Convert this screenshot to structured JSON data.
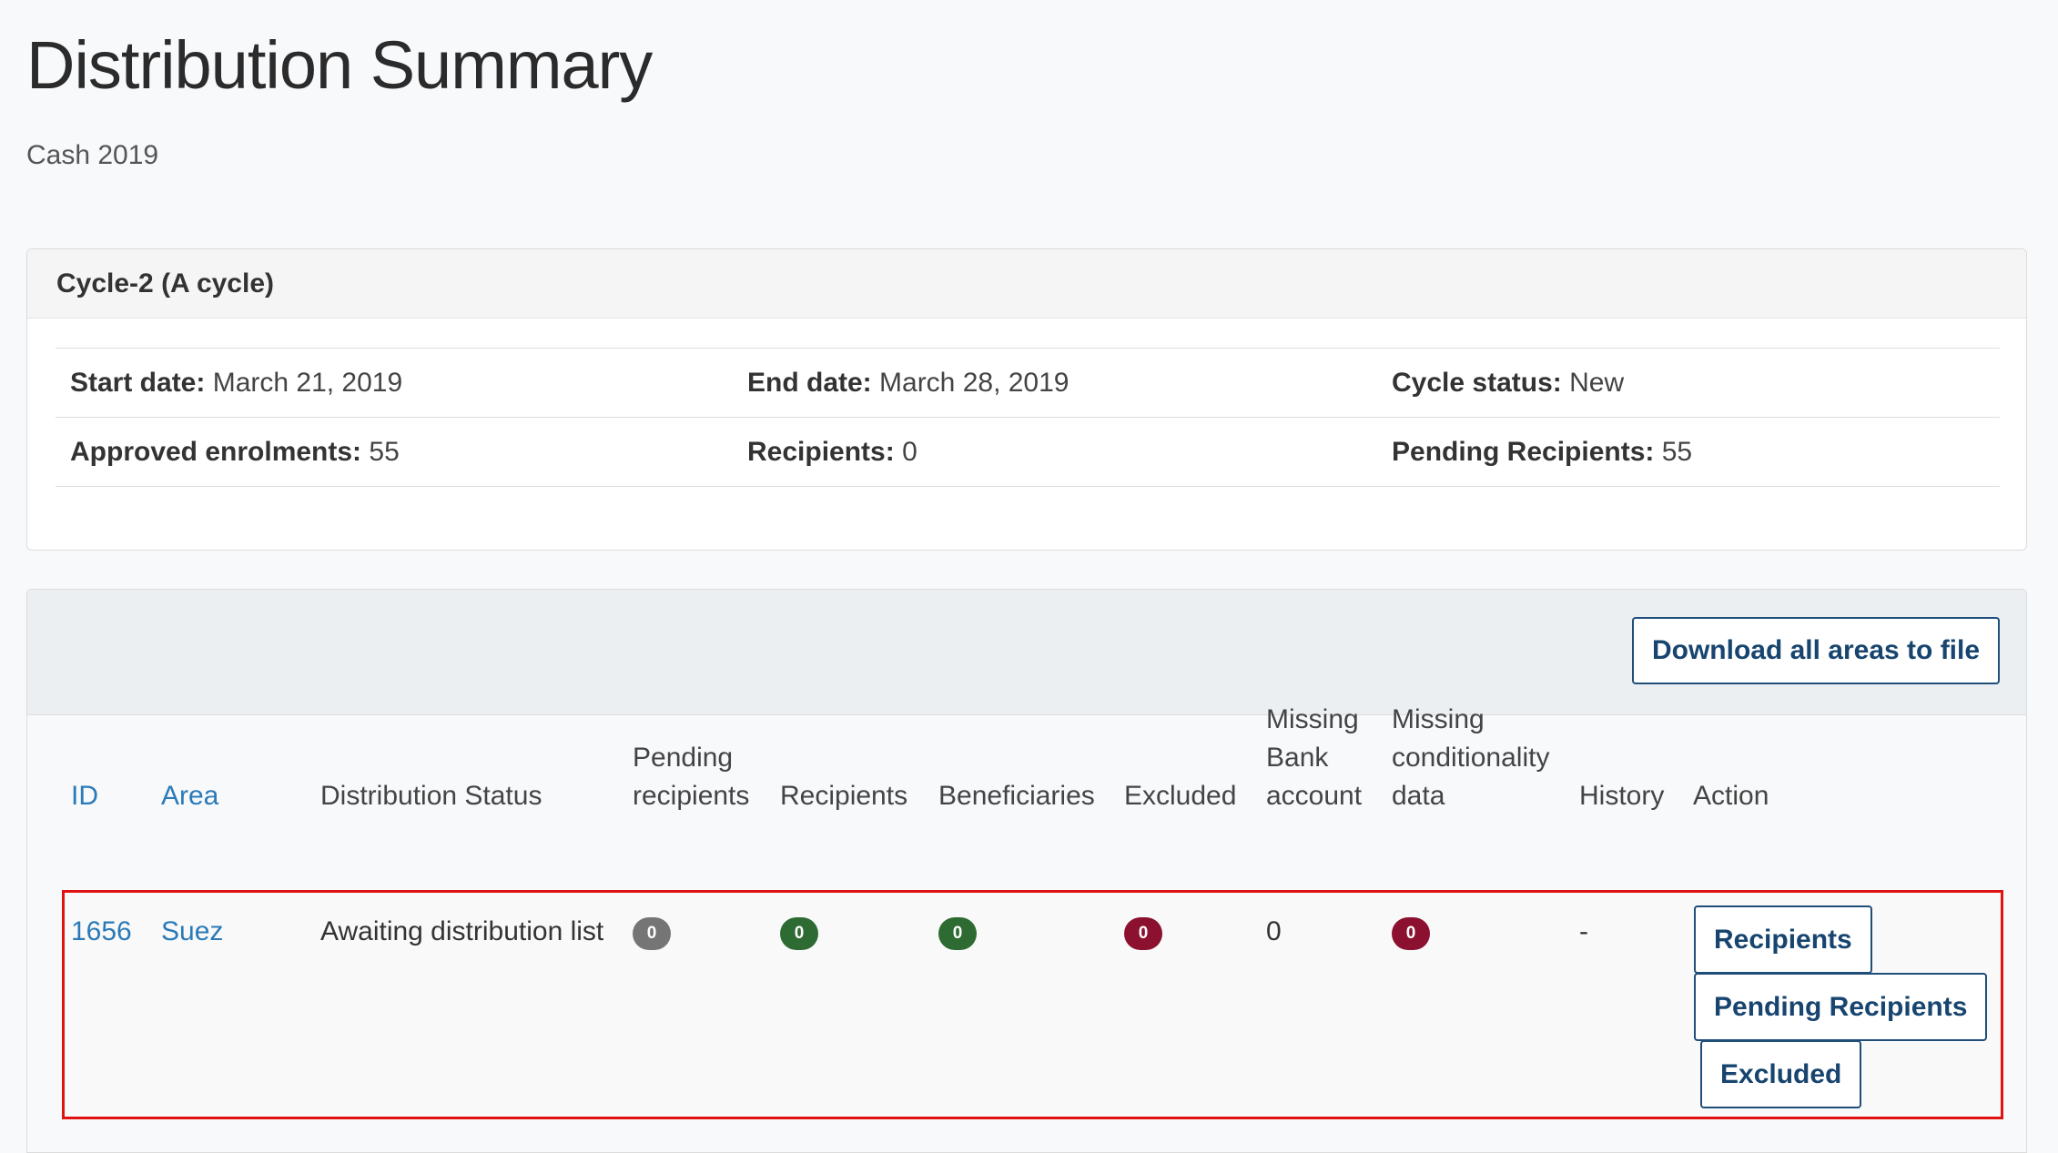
{
  "page": {
    "title": "Distribution Summary",
    "subtitle": "Cash 2019"
  },
  "cycle": {
    "header": "Cycle-2 (A cycle)",
    "start_date_label": "Start date:",
    "start_date": "March 21, 2019",
    "end_date_label": "End date:",
    "end_date": "March 28, 2019",
    "status_label": "Cycle status:",
    "status": "New",
    "approved_label": "Approved enrolments:",
    "approved": "55",
    "recipients_label": "Recipients:",
    "recipients": "0",
    "pending_label": "Pending Recipients:",
    "pending": "55"
  },
  "areas": {
    "download_label": "Download all areas to file",
    "columns": {
      "id": "ID",
      "area": "Area",
      "status": "Distribution Status",
      "pending_1": "Pending",
      "pending_2": "recipients",
      "recipients": "Recipients",
      "beneficiaries": "Beneficiaries",
      "excluded": "Excluded",
      "bank_1": "Missing",
      "bank_2": "Bank",
      "bank_3": "account",
      "cond_1": "Missing",
      "cond_2": "conditionality",
      "cond_3": "data",
      "history": "History",
      "action": "Action"
    },
    "rows": [
      {
        "id": "1656",
        "area": "Suez",
        "status": "Awaiting distribution list",
        "pending": "0",
        "recipients": "0",
        "beneficiaries": "0",
        "excluded": "0",
        "missing_bank": "0",
        "missing_cond": "0",
        "history": "-",
        "actions": {
          "recipients": "Recipients",
          "pending": "Pending Recipients",
          "excluded": "Excluded"
        }
      }
    ]
  },
  "colors": {
    "badge_grey": "#757575",
    "badge_green": "#2e6b32",
    "badge_red": "#8c1030",
    "highlight_border": "#e01212",
    "link": "#2a7ab8",
    "button_text": "#17456f"
  }
}
